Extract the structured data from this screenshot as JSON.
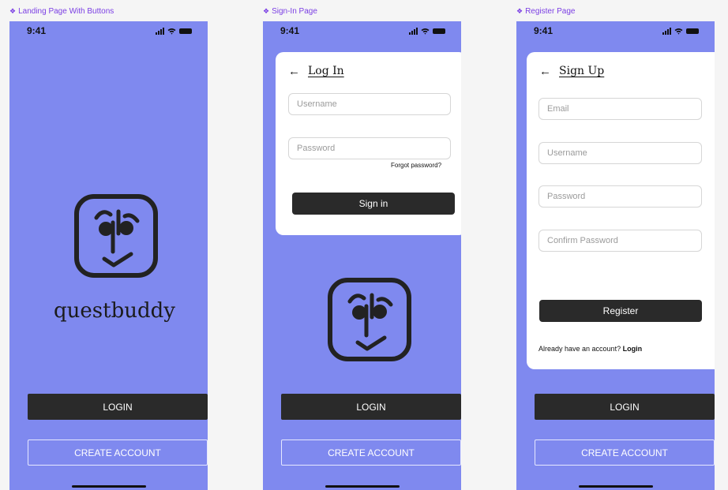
{
  "frames": [
    {
      "label": "Landing Page With Buttons"
    },
    {
      "label": "Sign-In Page"
    },
    {
      "label": "Register Page"
    }
  ],
  "status": {
    "time": "9:41"
  },
  "brand": {
    "wordmark": "questbuddy"
  },
  "buttons": {
    "login": "LOGIN",
    "create_account": "CREATE ACCOUNT"
  },
  "signin": {
    "title": "Log In",
    "username_placeholder": "Username",
    "password_placeholder": "Password",
    "forgot": "Forgot password?",
    "submit": "Sign in"
  },
  "register": {
    "title": "Sign Up",
    "email_placeholder": "Email",
    "username_placeholder": "Username",
    "password_placeholder": "Password",
    "confirm_placeholder": "Confirm Password",
    "submit": "Register",
    "have_account": "Already have an account?",
    "login_link": "Login"
  },
  "colors": {
    "phone_bg": "#7f89ef",
    "button_dark": "#2a2a2a",
    "frame_label": "#7b3fe4"
  },
  "icons": [
    "diamond-icon",
    "signal-icon",
    "wifi-icon",
    "battery-icon",
    "back-arrow-icon",
    "questbuddy-logo-icon"
  ]
}
